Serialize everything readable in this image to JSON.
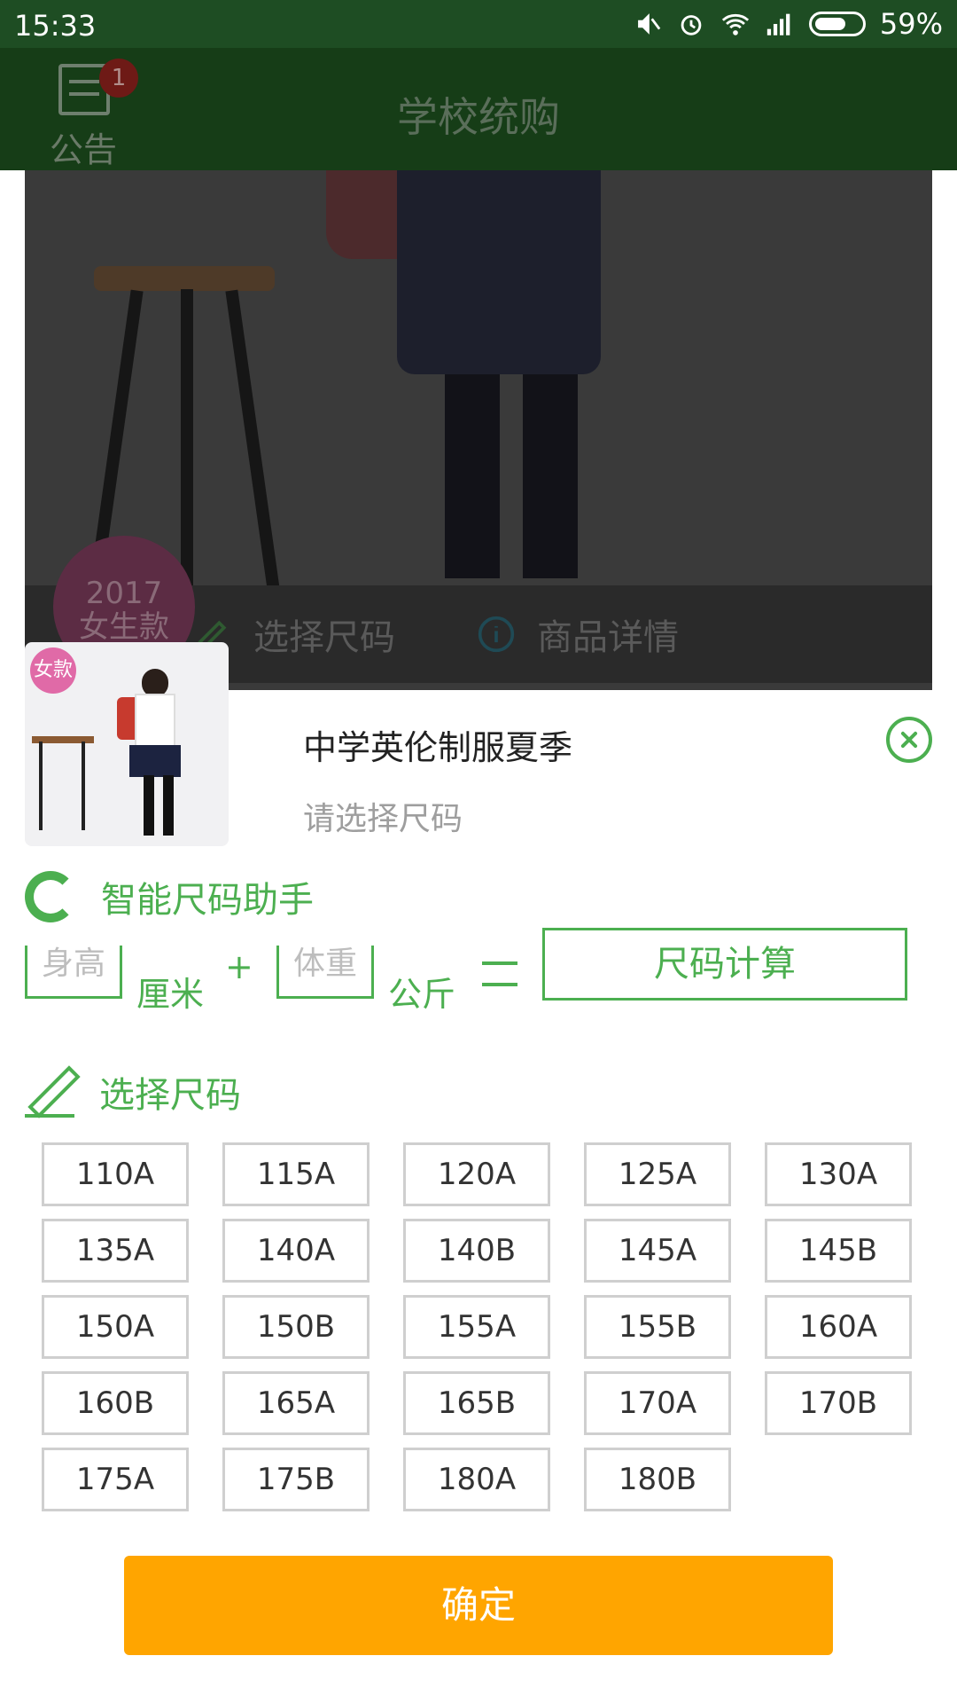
{
  "status_bar": {
    "time": "15:33",
    "battery": "59%"
  },
  "app_bar": {
    "title": "学校统购",
    "notice_label": "公告",
    "notice_badge": "1"
  },
  "hero": {
    "stamp_year": "2017",
    "stamp_label": "女生款",
    "select_size_label": "选择尺码",
    "details_label": "商品详情"
  },
  "sheet": {
    "thumb_tag": "女款",
    "product_title": "中学英伦制服夏季",
    "product_subtitle": "请选择尺码",
    "assistant_title": "智能尺码助手",
    "height_placeholder": "身高",
    "height_unit": "厘米",
    "plus": "+",
    "weight_placeholder": "体重",
    "weight_unit": "公斤",
    "calc_button": "尺码计算",
    "select_title": "选择尺码",
    "sizes": [
      "110A",
      "115A",
      "120A",
      "125A",
      "130A",
      "135A",
      "140A",
      "140B",
      "145A",
      "145B",
      "150A",
      "150B",
      "155A",
      "155B",
      "160A",
      "160B",
      "165A",
      "165B",
      "170A",
      "170B",
      "175A",
      "175B",
      "180A",
      "180B"
    ],
    "confirm_button": "确定"
  },
  "colors": {
    "accent": "#4caf50",
    "confirm": "#ffa500",
    "status_bar": "#1e4d23"
  }
}
